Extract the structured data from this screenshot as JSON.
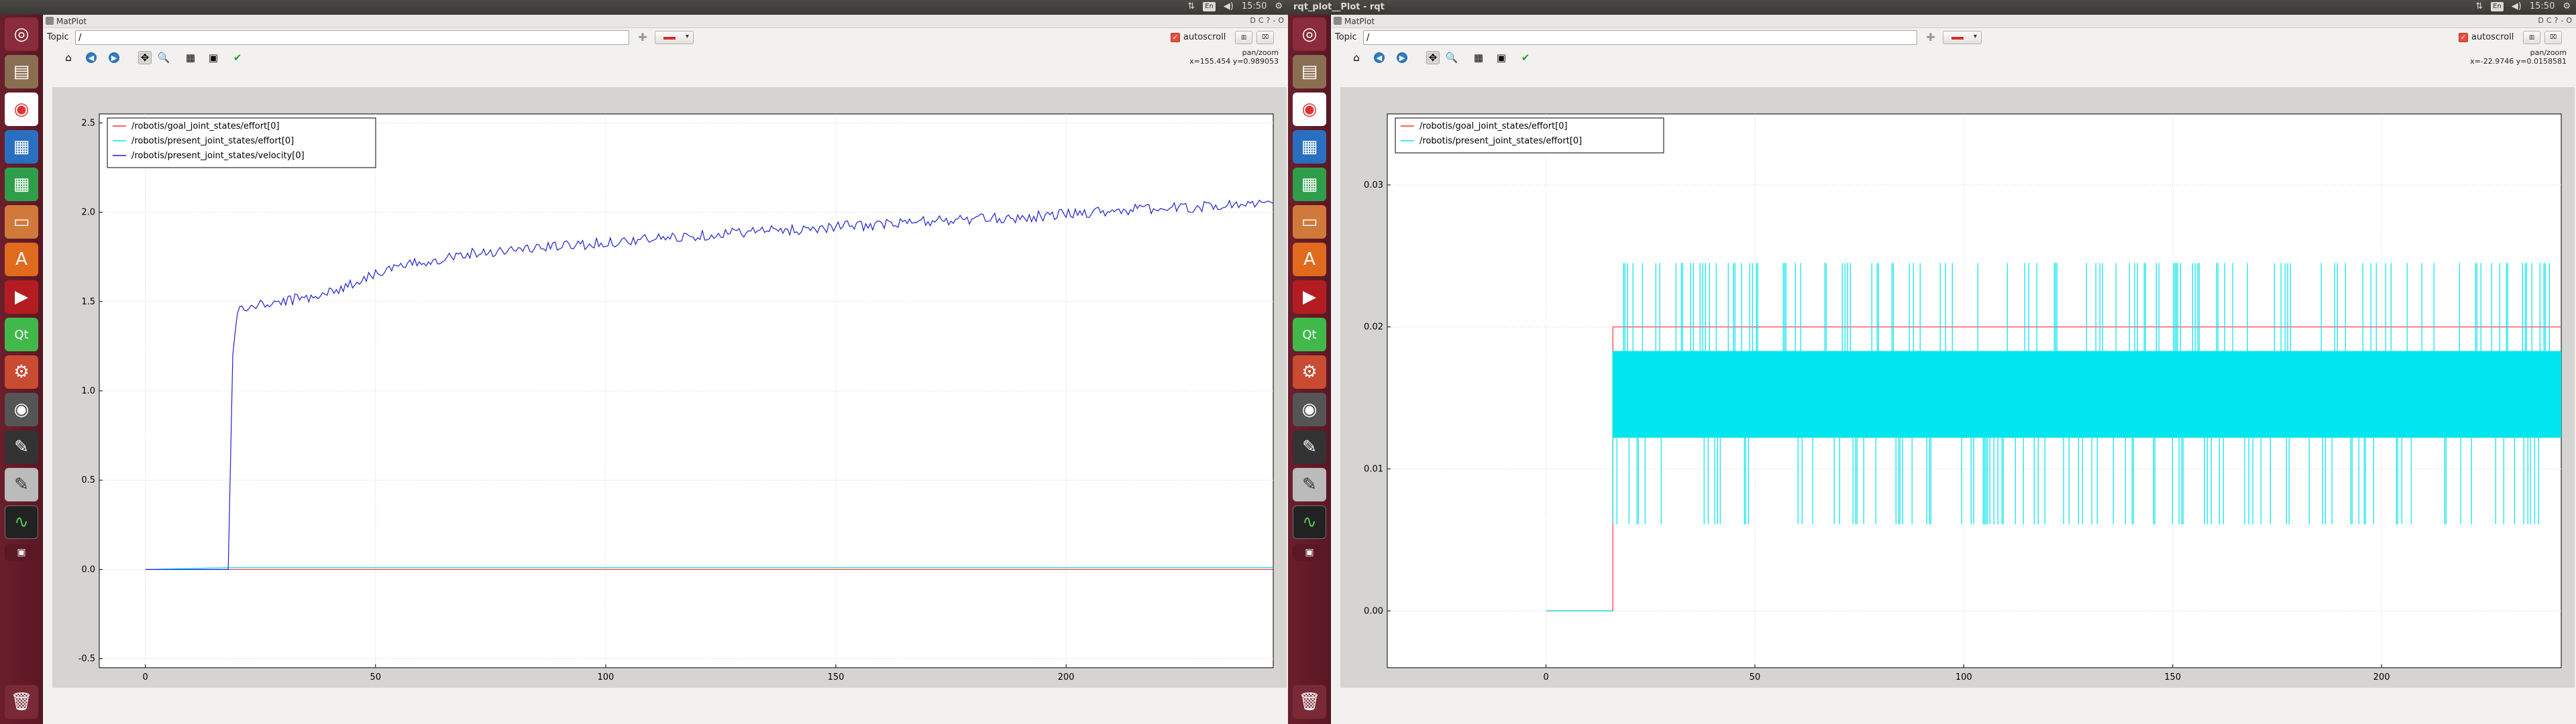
{
  "left": {
    "top_panel": {
      "title": "",
      "time": "15:50",
      "kbd": "En"
    },
    "window": {
      "plugin_title": "MatPlot",
      "controls": [
        "D",
        "C",
        "?",
        "-",
        "O"
      ],
      "topic_label": "Topic",
      "topic_value": "/",
      "autoscroll_label": "autoscroll",
      "checked": true,
      "mode": "pan/zoom",
      "coords": "x=155.454    y=0.989053"
    },
    "chart_data": {
      "type": "line",
      "xlim": [
        -10,
        245
      ],
      "ylim": [
        -0.55,
        2.55
      ],
      "xticks": [
        0,
        50,
        100,
        150,
        200
      ],
      "yticks": [
        -0.5,
        0.0,
        0.5,
        1.0,
        1.5,
        2.0,
        2.5
      ],
      "ytick_labels": [
        "-0.5",
        "0.0",
        "0.5",
        "1.0",
        "1.5",
        "2.0",
        "2.5"
      ],
      "grid": true,
      "legend_position": "top-left",
      "series": [
        {
          "name": "/robotis/goal_joint_states/effort[0]",
          "color": "#ff3030",
          "x": [
            0,
            245
          ],
          "y": [
            0,
            0
          ]
        },
        {
          "name": "/robotis/present_joint_states/effort[0]",
          "color": "#00e5ee",
          "x": [
            0,
            18,
            245
          ],
          "y": [
            0,
            0.01,
            0.01
          ]
        },
        {
          "name": "/robotis/present_joint_states/velocity[0]",
          "color": "#1f1fd0",
          "x": [
            0,
            18,
            19,
            20,
            25,
            30,
            40,
            45,
            50,
            60,
            70,
            80,
            90,
            100,
            110,
            120,
            130,
            140,
            150,
            160,
            170,
            180,
            190,
            200,
            210,
            220,
            230,
            240,
            245
          ],
          "y": [
            0,
            0,
            1.2,
            1.45,
            1.48,
            1.5,
            1.55,
            1.6,
            1.66,
            1.72,
            1.77,
            1.79,
            1.81,
            1.83,
            1.85,
            1.87,
            1.89,
            1.9,
            1.92,
            1.93,
            1.95,
            1.96,
            1.97,
            1.99,
            2.01,
            2.02,
            2.03,
            2.05,
            2.05
          ]
        }
      ]
    }
  },
  "right": {
    "top_panel": {
      "title": "rqt_plot__Plot - rqt",
      "time": "15:50",
      "kbd": "En"
    },
    "window": {
      "plugin_title": "MatPlot",
      "controls": [
        "D",
        "C",
        "?",
        "-",
        "O"
      ],
      "topic_label": "Topic",
      "topic_value": "/",
      "autoscroll_label": "autoscroll",
      "checked": true,
      "mode": "pan/zoom",
      "coords": "x=-22.9746    y=0.0158581"
    },
    "chart_data": {
      "type": "line",
      "xlim": [
        -38,
        243
      ],
      "ylim": [
        -0.004,
        0.035
      ],
      "xticks": [
        0,
        50,
        100,
        150,
        200
      ],
      "yticks": [
        0.0,
        0.01,
        0.02,
        0.03
      ],
      "ytick_labels": [
        "0.00",
        "0.01",
        "0.02",
        "0.03"
      ],
      "grid": true,
      "legend_position": "top-left",
      "series": [
        {
          "name": "/robotis/goal_joint_states/effort[0]",
          "color": "#ff3030",
          "x": [
            0,
            16,
            16,
            243
          ],
          "y": [
            0,
            0,
            0.02,
            0.02
          ]
        },
        {
          "name": "/robotis/present_joint_states/effort[0]",
          "color": "#00e5ee",
          "noise": {
            "start": 16,
            "end": 243,
            "band_low": 0.0122,
            "band_high": 0.0183,
            "spike_high": 0.0245,
            "spike_low": 0.0061
          }
        }
      ]
    }
  }
}
